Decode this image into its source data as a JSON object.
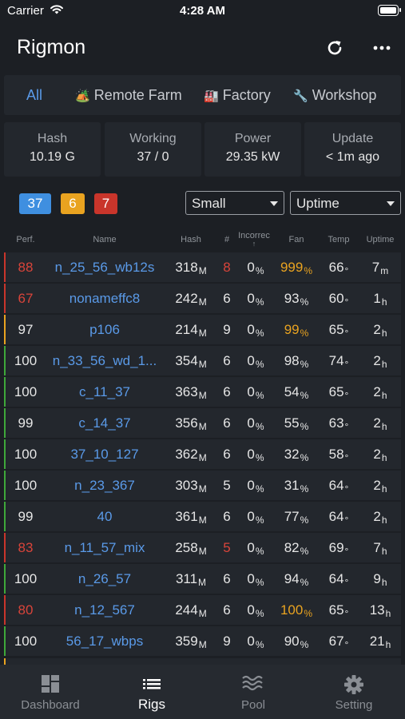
{
  "status_bar": {
    "carrier": "Carrier",
    "time": "4:28 AM"
  },
  "nav": {
    "title": "Rigmon"
  },
  "farm_tabs": [
    {
      "label": "All",
      "icon": ""
    },
    {
      "label": "Remote Farm",
      "icon": "🏕️"
    },
    {
      "label": "Factory",
      "icon": "🏭"
    },
    {
      "label": "Workshop",
      "icon": "🔧"
    }
  ],
  "stats": [
    {
      "label": "Hash",
      "value": "10.19 G"
    },
    {
      "label": "Working",
      "value": "37 / 0"
    },
    {
      "label": "Power",
      "value": "29.35 kW"
    },
    {
      "label": "Update",
      "value": "< 1m ago"
    }
  ],
  "badges": [
    {
      "count": "37",
      "color": "#3f8fe0"
    },
    {
      "count": "6",
      "color": "#e9a320"
    },
    {
      "count": "7",
      "color": "#c9352b"
    }
  ],
  "filters": {
    "size": "Small",
    "sort": "Uptime"
  },
  "table": {
    "headers": {
      "perf": "Perf.",
      "name": "Name",
      "hash": "Hash",
      "num": "#",
      "incorrect": "Incorrec",
      "incorrect_arrow": "↑",
      "fan": "Fan",
      "temp": "Temp",
      "uptime": "Uptime"
    },
    "rows": [
      {
        "perf": "88",
        "name": "n_25_56_wb12s",
        "hash": "318",
        "hash_unit": "M",
        "num": "8",
        "inc": "0",
        "fan": "999",
        "temp": "66",
        "up": "7",
        "up_unit": "m",
        "status": "red",
        "num_alert": true,
        "fan_alert": true
      },
      {
        "perf": "67",
        "name": "nonameffc8",
        "hash": "242",
        "hash_unit": "M",
        "num": "6",
        "inc": "0",
        "fan": "93",
        "temp": "60",
        "up": "1",
        "up_unit": "h",
        "status": "red",
        "num_alert": false,
        "fan_alert": false
      },
      {
        "perf": "97",
        "name": "p106",
        "hash": "214",
        "hash_unit": "M",
        "num": "9",
        "inc": "0",
        "fan": "99",
        "temp": "65",
        "up": "2",
        "up_unit": "h",
        "status": "yellow",
        "num_alert": false,
        "fan_alert": true
      },
      {
        "perf": "100",
        "name": "n_33_56_wd_1...",
        "hash": "354",
        "hash_unit": "M",
        "num": "6",
        "inc": "0",
        "fan": "98",
        "temp": "74",
        "up": "2",
        "up_unit": "h",
        "status": "green",
        "num_alert": false,
        "fan_alert": false
      },
      {
        "perf": "100",
        "name": "c_11_37",
        "hash": "363",
        "hash_unit": "M",
        "num": "6",
        "inc": "0",
        "fan": "54",
        "temp": "65",
        "up": "2",
        "up_unit": "h",
        "status": "green",
        "num_alert": false,
        "fan_alert": false
      },
      {
        "perf": "99",
        "name": "c_14_37",
        "hash": "356",
        "hash_unit": "M",
        "num": "6",
        "inc": "0",
        "fan": "55",
        "temp": "63",
        "up": "2",
        "up_unit": "h",
        "status": "green",
        "num_alert": false,
        "fan_alert": false
      },
      {
        "perf": "100",
        "name": "37_10_127",
        "hash": "362",
        "hash_unit": "M",
        "num": "6",
        "inc": "0",
        "fan": "32",
        "temp": "58",
        "up": "2",
        "up_unit": "h",
        "status": "green",
        "num_alert": false,
        "fan_alert": false
      },
      {
        "perf": "100",
        "name": "n_23_367",
        "hash": "303",
        "hash_unit": "M",
        "num": "5",
        "inc": "0",
        "fan": "31",
        "temp": "64",
        "up": "2",
        "up_unit": "h",
        "status": "green",
        "num_alert": false,
        "fan_alert": false
      },
      {
        "perf": "99",
        "name": "40",
        "hash": "361",
        "hash_unit": "M",
        "num": "6",
        "inc": "0",
        "fan": "77",
        "temp": "64",
        "up": "2",
        "up_unit": "h",
        "status": "green",
        "num_alert": false,
        "fan_alert": false
      },
      {
        "perf": "83",
        "name": "n_11_57_mix",
        "hash": "258",
        "hash_unit": "M",
        "num": "5",
        "inc": "0",
        "fan": "82",
        "temp": "69",
        "up": "7",
        "up_unit": "h",
        "status": "red",
        "num_alert": true,
        "fan_alert": false
      },
      {
        "perf": "100",
        "name": "n_26_57",
        "hash": "311",
        "hash_unit": "M",
        "num": "6",
        "inc": "0",
        "fan": "94",
        "temp": "64",
        "up": "9",
        "up_unit": "h",
        "status": "green",
        "num_alert": false,
        "fan_alert": false
      },
      {
        "perf": "80",
        "name": "n_12_567",
        "hash": "244",
        "hash_unit": "M",
        "num": "6",
        "inc": "0",
        "fan": "100",
        "temp": "65",
        "up": "13",
        "up_unit": "h",
        "status": "red",
        "num_alert": false,
        "fan_alert": true
      },
      {
        "perf": "100",
        "name": "56_17_wbps",
        "hash": "359",
        "hash_unit": "M",
        "num": "9",
        "inc": "0",
        "fan": "90",
        "temp": "67",
        "up": "21",
        "up_unit": "h",
        "status": "green",
        "num_alert": false,
        "fan_alert": false
      }
    ],
    "units": {
      "percent": "%",
      "degree": "°"
    }
  },
  "status_colors": {
    "red": "#c9352b",
    "yellow": "#e9a320",
    "green": "#3fa83a",
    "alert_text": "#d9443a",
    "fan_warn": "#e9a320",
    "normal_text": "#e6e6e6"
  },
  "tabbar": [
    {
      "label": "Dashboard",
      "icon": "dashboard-icon"
    },
    {
      "label": "Rigs",
      "icon": "list-icon"
    },
    {
      "label": "Pool",
      "icon": "waves-icon"
    },
    {
      "label": "Setting",
      "icon": "gear-icon"
    }
  ]
}
